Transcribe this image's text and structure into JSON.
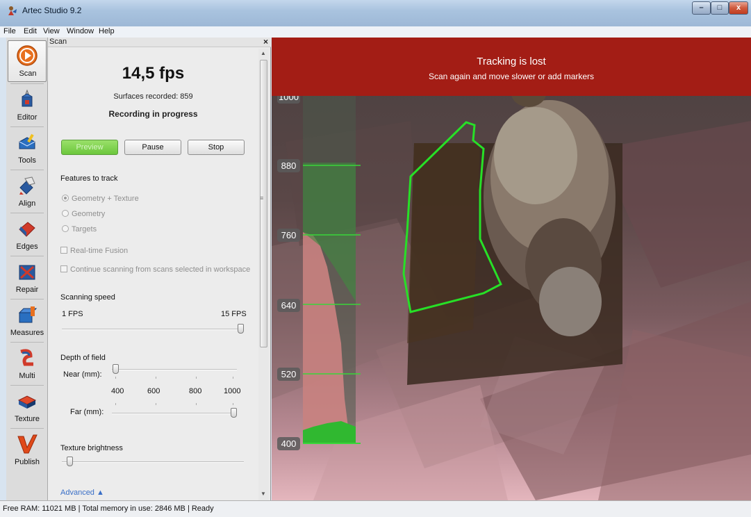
{
  "window": {
    "title": "Artec Studio 9.2",
    "controls": {
      "minimize": "–",
      "maximize": "□",
      "close": "x"
    }
  },
  "menu": [
    "File",
    "Edit",
    "View",
    "Window",
    "Help"
  ],
  "tools": [
    {
      "label": "Scan",
      "icon": "scan-play-icon",
      "active": true
    },
    {
      "label": "Editor",
      "icon": "editor-icon"
    },
    {
      "label": "Tools",
      "icon": "tools-icon"
    },
    {
      "label": "Align",
      "icon": "align-icon"
    },
    {
      "label": "Edges",
      "icon": "edges-icon"
    },
    {
      "label": "Repair",
      "icon": "repair-icon"
    },
    {
      "label": "Measures",
      "icon": "measures-icon"
    },
    {
      "label": "Multi",
      "icon": "multi-icon"
    },
    {
      "label": "Texture",
      "icon": "texture-icon"
    },
    {
      "label": "Publish",
      "icon": "publish-icon"
    }
  ],
  "scan_panel": {
    "title": "Scan",
    "close": "×",
    "fps": "14,5 fps",
    "surfaces": "Surfaces recorded: 859",
    "status": "Recording in progress",
    "buttons": {
      "preview": "Preview",
      "pause": "Pause",
      "stop": "Stop"
    },
    "features_heading": "Features to track",
    "features": [
      {
        "label": "Geometry + Texture",
        "selected": true
      },
      {
        "label": "Geometry",
        "selected": false
      },
      {
        "label": "Targets",
        "selected": false
      }
    ],
    "realtime_fusion": "Real-time Fusion",
    "continue_scanning": "Continue scanning from scans selected in workspace",
    "scanning_speed": {
      "heading": "Scanning speed",
      "min": "1 FPS",
      "max": "15 FPS",
      "value_fraction": 1.0
    },
    "depth_of_field": {
      "heading": "Depth of field",
      "near_label": "Near (mm):",
      "far_label": "Far (mm):",
      "scale": [
        "400",
        "600",
        "800",
        "1000"
      ],
      "near_fraction": 0.0,
      "far_fraction": 1.0
    },
    "texture_brightness": {
      "heading": "Texture brightness",
      "value_fraction": 0.03
    },
    "advanced": "Advanced ▲"
  },
  "viewport": {
    "banner_title": "Tracking is lost",
    "banner_subtitle": "Scan again and move slower or add markers",
    "depth_labels": [
      "1000",
      "880",
      "760",
      "640",
      "520",
      "400"
    ]
  },
  "status_bar": "Free RAM: 11021 MB  |  Total memory in use: 2846 MB  |   Ready",
  "colors": {
    "banner": "#a31d15",
    "preview_button": "#7ed04e",
    "depth_line": "#39d639",
    "tracking_outline": "#27e027",
    "link": "#3a6fc7"
  }
}
